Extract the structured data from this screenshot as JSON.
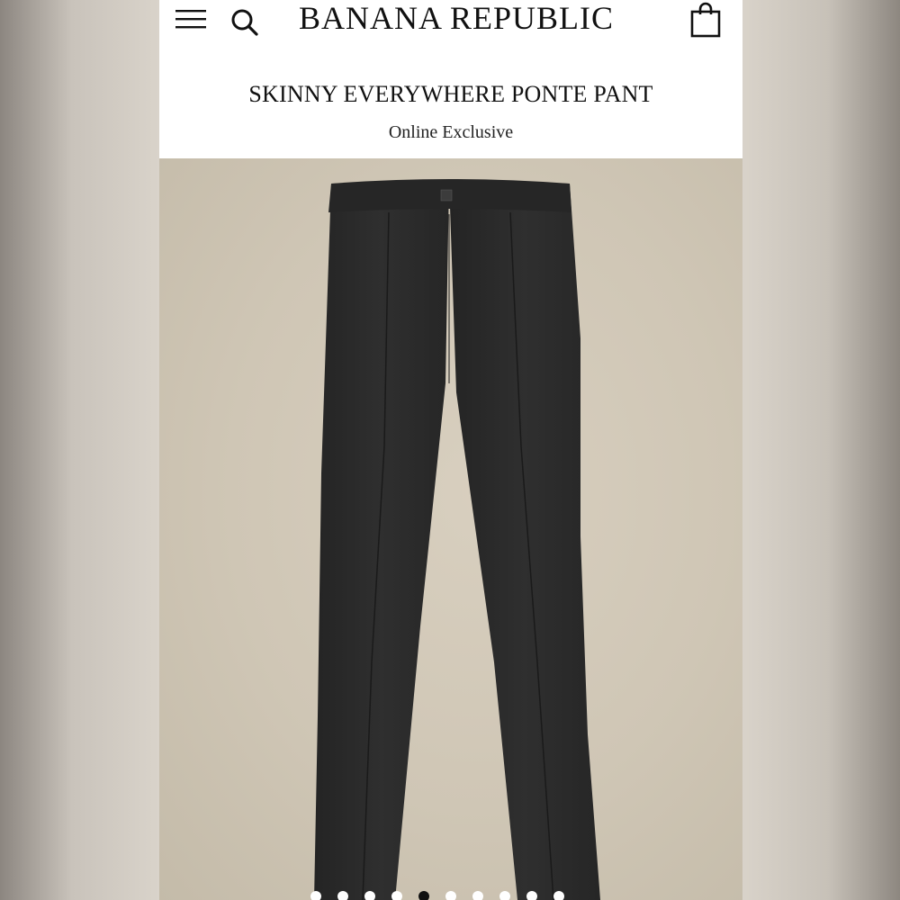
{
  "header": {
    "brand": "BANANA REPUBLIC",
    "icons": [
      "menu-icon",
      "search-icon",
      "shopping-bag-icon"
    ]
  },
  "product": {
    "title": "SKINNY EVERYWHERE PONTE PANT",
    "subtitle": "Online Exclusive",
    "image_name": "product-image-pant",
    "color": "#2b2b2b"
  },
  "carousel": {
    "slide_count": 10,
    "active_index": 4
  },
  "colors": {
    "background": "#d9d3ca",
    "header_bg": "#ffffff",
    "product_bg": "#cfc6b5",
    "text": "#111111"
  }
}
